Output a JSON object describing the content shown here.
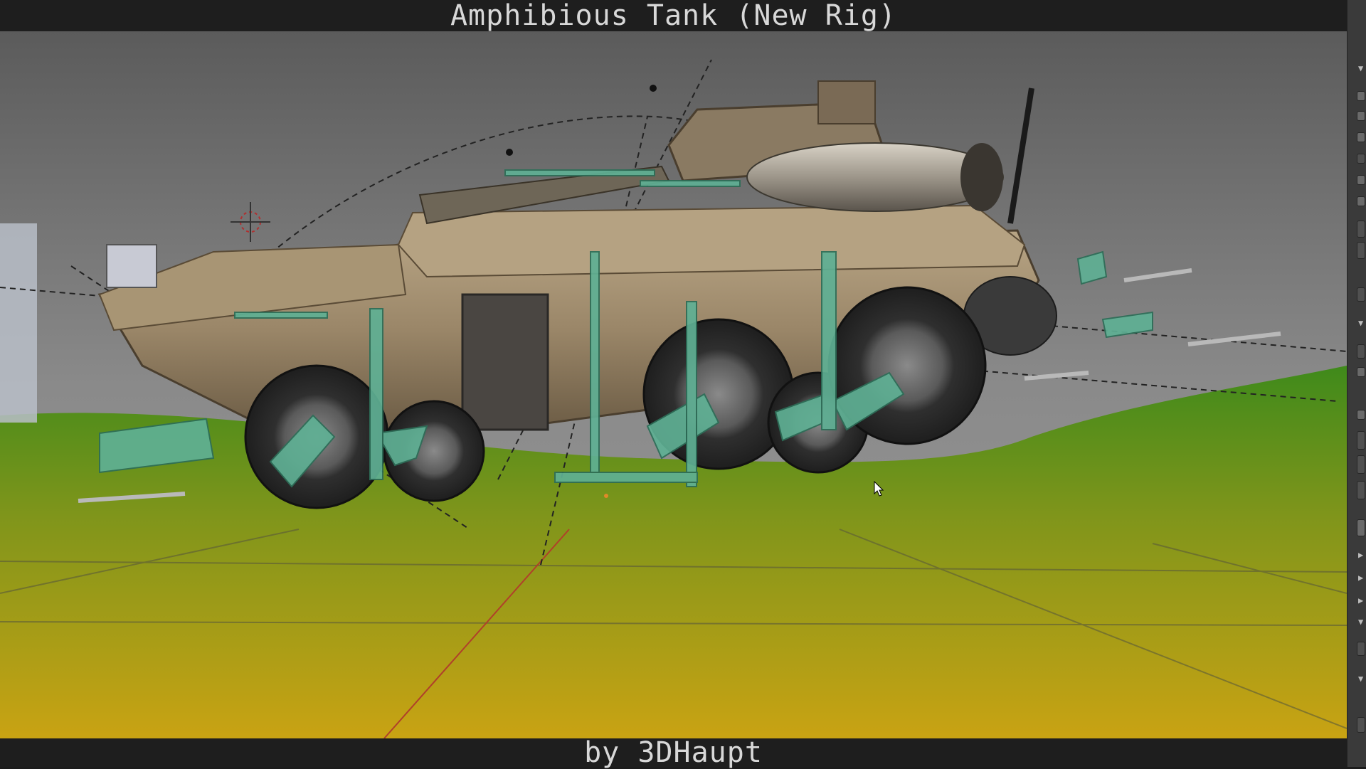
{
  "window": {
    "title": "Amphibious Tank (New Rig)",
    "footer": "by 3DHaupt"
  },
  "viewport": {
    "ground_color_top": "#4a8a1e",
    "ground_color_bottom": "#b89a14",
    "sky_color": "#8d8d8d",
    "hill_color": "#3f8a1a",
    "tank_body_color": "#a08c6c",
    "bone_color": "#5fb094",
    "wheel_color": "#3a3a3a"
  },
  "right_panel": {
    "controls": 22,
    "background": "#3a3a3a"
  },
  "icons": {
    "cursor": "mouse-pointer-icon",
    "crosshair": "3d-cursor-icon",
    "dropdown": "triangle-down-icon",
    "collapsed": "triangle-right-icon"
  }
}
